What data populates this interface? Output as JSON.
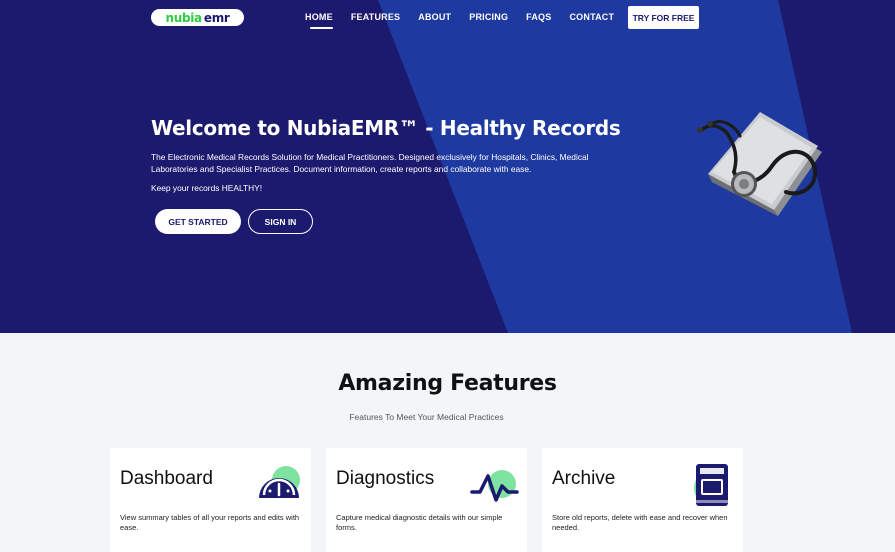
{
  "brand": {
    "logo_part1": "nubia",
    "logo_part2": "emr",
    "colors": {
      "primary": "#1c1a6e",
      "secondary": "#1e3aa0",
      "accent": "#2ecc40",
      "mint": "#7ee3a0"
    }
  },
  "nav": {
    "items": [
      {
        "label": "HOME",
        "active": true
      },
      {
        "label": "FEATURES"
      },
      {
        "label": "ABOUT"
      },
      {
        "label": "PRICING"
      },
      {
        "label": "FAQS"
      },
      {
        "label": "CONTACT"
      }
    ],
    "cta_label": "TRY FOR FREE"
  },
  "hero": {
    "title": "Welcome to NubiaEMR™ - Healthy Records",
    "description": "The Electronic Medical Records Solution for Medical Practitioners. Designed exclusively for Hospitals, Clinics, Medical Laboratories and Specialist Practices. Document information, create reports and collaborate with ease.",
    "tagline": "Keep your records HEALTHY!",
    "primary_button": "GET STARTED",
    "secondary_button": "SIGN IN",
    "art_icon": "stethoscope-folder-icon"
  },
  "features": {
    "title": "Amazing Features",
    "subtitle": "Features To Meet Your Medical Practices",
    "cards": [
      {
        "title": "Dashboard",
        "description": "View summary tables of all your reports and edits with ease.",
        "icon": "gauge-icon"
      },
      {
        "title": "Diagnostics",
        "description": "Capture medical diagnostic details with our simple forms.",
        "icon": "pulse-icon"
      },
      {
        "title": "Archive",
        "description": "Store old reports, delete with ease and recover when needed.",
        "icon": "archive-book-icon"
      }
    ]
  }
}
